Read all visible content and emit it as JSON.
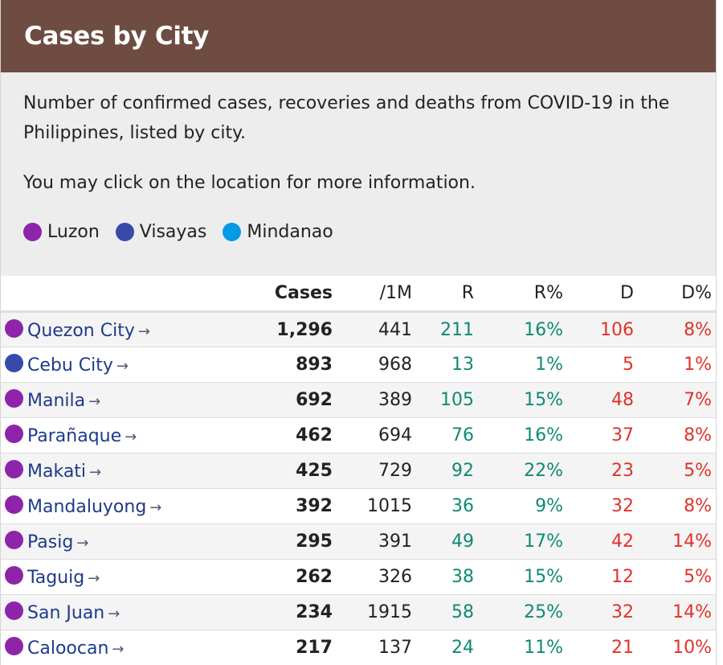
{
  "header": {
    "title": "Cases by City"
  },
  "intro": {
    "description": "Number of confirmed cases, recoveries and deaths from COVID-19 in the Philippines, listed by city.",
    "hint": "You may click on the location for more information."
  },
  "legend": [
    {
      "label": "Luzon",
      "color": "#8e24aa"
    },
    {
      "label": "Visayas",
      "color": "#3949ab"
    },
    {
      "label": "Mindanao",
      "color": "#039be5"
    }
  ],
  "table": {
    "headers": {
      "cases": "Cases",
      "per_million": "/1M",
      "recovered": "R",
      "recovered_pct": "R%",
      "deaths": "D",
      "deaths_pct": "D%"
    },
    "arrow": "→",
    "rows": [
      {
        "region": "luzon",
        "city": "Quezon City",
        "cases": "1,296",
        "per_million": "441",
        "recovered": "211",
        "recovered_pct": "16%",
        "deaths": "106",
        "deaths_pct": "8%"
      },
      {
        "region": "visayas",
        "city": "Cebu City",
        "cases": "893",
        "per_million": "968",
        "recovered": "13",
        "recovered_pct": "1%",
        "deaths": "5",
        "deaths_pct": "1%"
      },
      {
        "region": "luzon",
        "city": "Manila",
        "cases": "692",
        "per_million": "389",
        "recovered": "105",
        "recovered_pct": "15%",
        "deaths": "48",
        "deaths_pct": "7%"
      },
      {
        "region": "luzon",
        "city": "Parañaque",
        "cases": "462",
        "per_million": "694",
        "recovered": "76",
        "recovered_pct": "16%",
        "deaths": "37",
        "deaths_pct": "8%"
      },
      {
        "region": "luzon",
        "city": "Makati",
        "cases": "425",
        "per_million": "729",
        "recovered": "92",
        "recovered_pct": "22%",
        "deaths": "23",
        "deaths_pct": "5%"
      },
      {
        "region": "luzon",
        "city": "Mandaluyong",
        "cases": "392",
        "per_million": "1015",
        "recovered": "36",
        "recovered_pct": "9%",
        "deaths": "32",
        "deaths_pct": "8%"
      },
      {
        "region": "luzon",
        "city": "Pasig",
        "cases": "295",
        "per_million": "391",
        "recovered": "49",
        "recovered_pct": "17%",
        "deaths": "42",
        "deaths_pct": "14%"
      },
      {
        "region": "luzon",
        "city": "Taguig",
        "cases": "262",
        "per_million": "326",
        "recovered": "38",
        "recovered_pct": "15%",
        "deaths": "12",
        "deaths_pct": "5%"
      },
      {
        "region": "luzon",
        "city": "San Juan",
        "cases": "234",
        "per_million": "1915",
        "recovered": "58",
        "recovered_pct": "25%",
        "deaths": "32",
        "deaths_pct": "14%"
      },
      {
        "region": "luzon",
        "city": "Caloocan",
        "cases": "217",
        "per_million": "137",
        "recovered": "24",
        "recovered_pct": "11%",
        "deaths": "21",
        "deaths_pct": "10%"
      }
    ]
  }
}
